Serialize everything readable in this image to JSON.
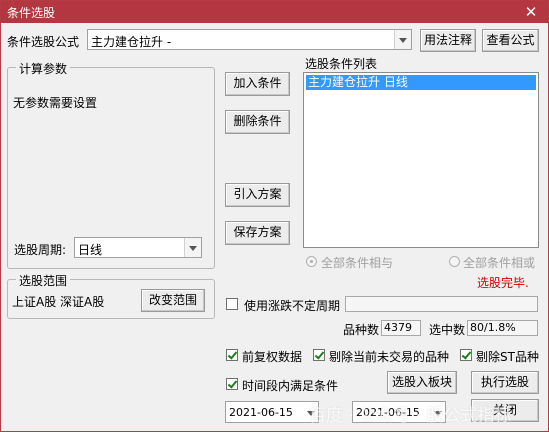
{
  "window": {
    "title": "条件选股",
    "close_glyph": "✕"
  },
  "formula": {
    "label": "条件选股公式",
    "value": "主力建仓拉升 -",
    "usage_button": "用法注释",
    "view_button": "查看公式"
  },
  "params": {
    "group_title": "计算参数",
    "message": "无参数需要设置",
    "period_label": "选股周期:",
    "period_value": "日线"
  },
  "buttons": {
    "add": "加入条件",
    "delete": "删除条件",
    "import": "引入方案",
    "save": "保存方案"
  },
  "conditions": {
    "title": "选股条件列表",
    "items": [
      "主力建仓拉升   日线"
    ]
  },
  "logic": {
    "and_label": "全部条件相与",
    "or_label": "全部条件相或",
    "and_selected": true
  },
  "status": {
    "text": "选股完毕.",
    "color": "#d40000"
  },
  "range": {
    "group_title": "选股范围",
    "value": "上证A股  深证A股",
    "change_button": "改变范围"
  },
  "variable_period": {
    "label": "使用涨跌不定周期",
    "checked": false
  },
  "counts": {
    "total_label": "品种数",
    "total_value": "4379",
    "selected_label": "选中数",
    "selected_value": "80/1.8%"
  },
  "options": {
    "fq_label": "前复权数据",
    "fq_checked": true,
    "exclude_untraded_label": "剔除当前未交易的品种",
    "exclude_untraded_checked": true,
    "exclude_st_label": "剔除ST品种",
    "exclude_st_checked": true,
    "time_range_label": "时间段内满足条件",
    "time_range_checked": true
  },
  "actions": {
    "to_block": "选股入板块",
    "run": "执行选股",
    "close": "关闭"
  },
  "dates": {
    "start": "2021-06-15",
    "end": "2021-06-15"
  },
  "watermark": "百度 · 公众号 · 股公式指标"
}
